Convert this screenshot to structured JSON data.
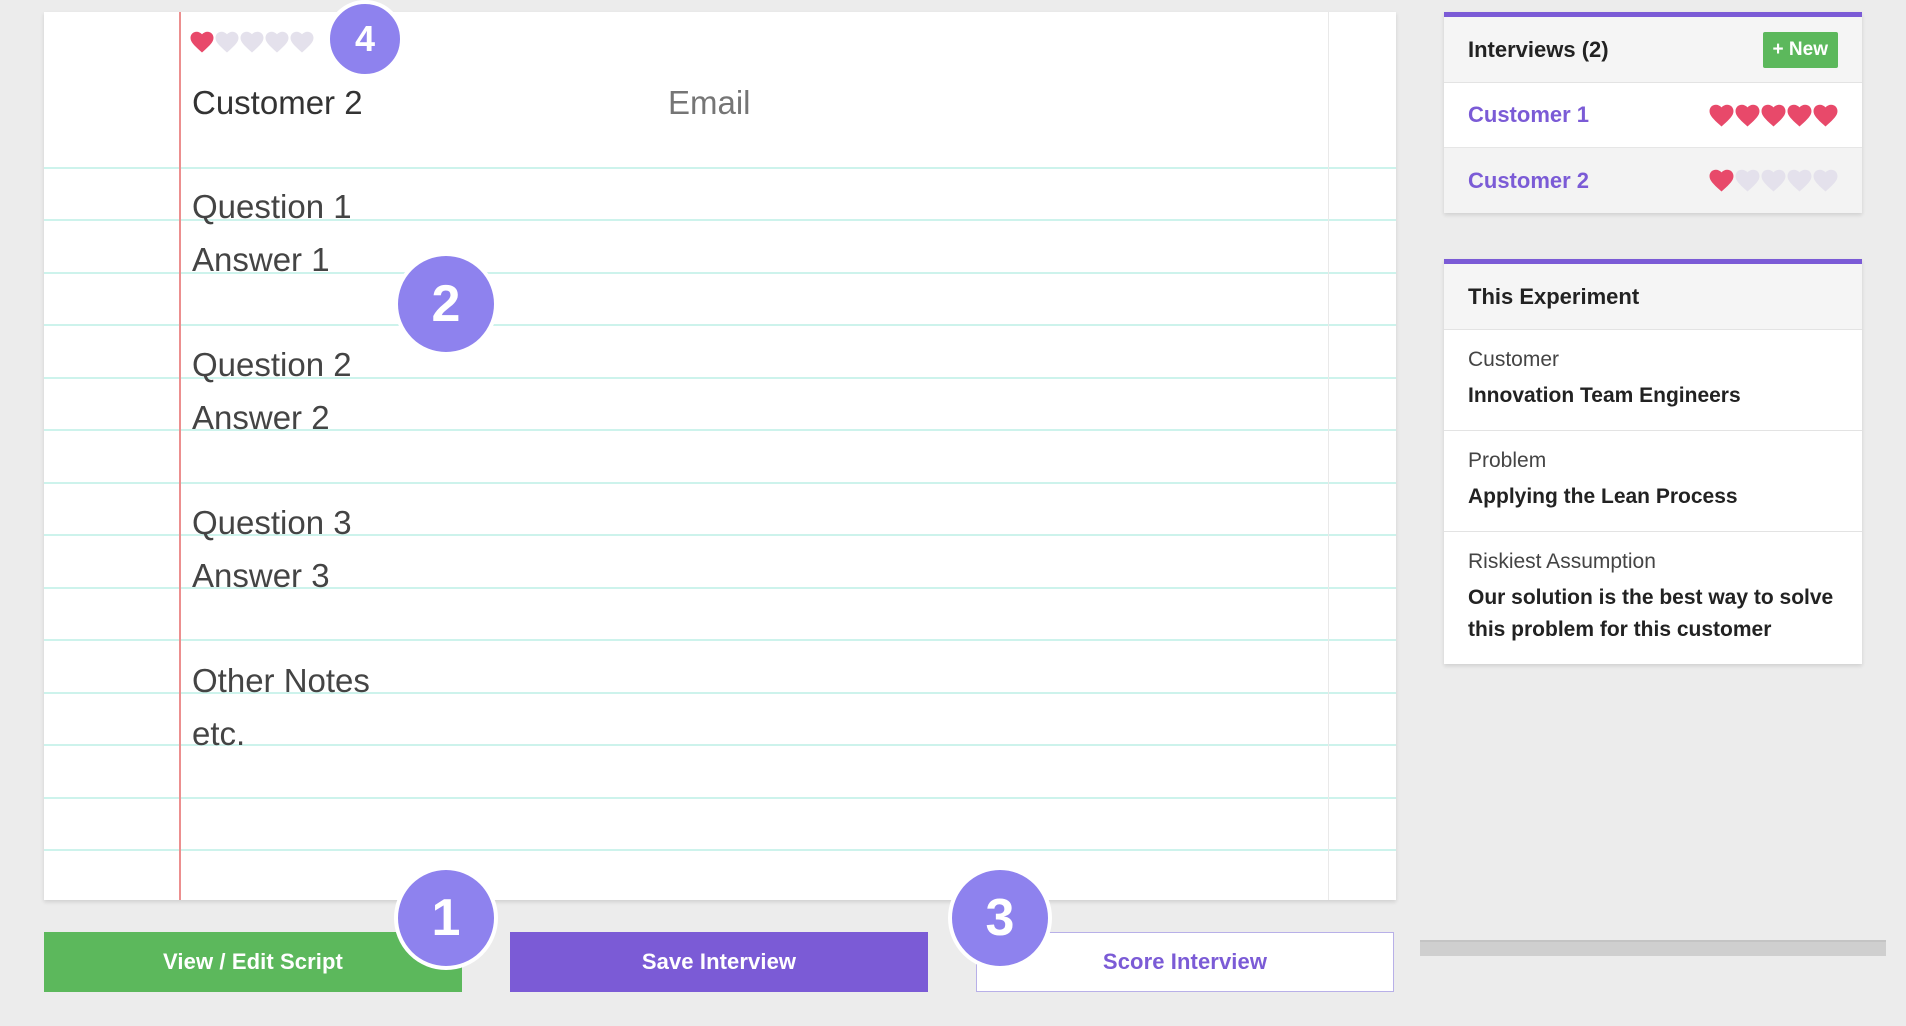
{
  "colors": {
    "accent_purple": "#7b5bd6",
    "button_green": "#5cb85c",
    "badge_purple": "#8e82ee",
    "heart_filled": "#e8496a",
    "heart_empty": "#e4e1ec",
    "paper_rule": "#cdf3ec",
    "paper_margin": "#ec8f8f"
  },
  "notebook": {
    "rating": 1,
    "rating_max": 5,
    "customer_name": "Customer 2",
    "email_placeholder": "Email",
    "lines": [
      "Question 1",
      "Answer 1",
      "Question 2",
      "Answer 2",
      "Question 3",
      "Answer 3",
      "Other Notes",
      "etc."
    ]
  },
  "callouts": {
    "one": "1",
    "two": "2",
    "three": "3",
    "four": "4"
  },
  "buttons": {
    "view_edit_script": "View / Edit Script",
    "save_interview": "Save Interview",
    "score_interview": "Score Interview"
  },
  "sidebar": {
    "interviews": {
      "title": "Interviews (2)",
      "new_label": "+ New",
      "items": [
        {
          "name": "Customer 1",
          "rating": 5,
          "active": false
        },
        {
          "name": "Customer 2",
          "rating": 1,
          "active": true
        }
      ]
    },
    "experiment": {
      "title": "This Experiment",
      "fields": [
        {
          "label": "Customer",
          "value": "Innovation Team Engineers"
        },
        {
          "label": "Problem",
          "value": "Applying the Lean Process"
        },
        {
          "label": "Riskiest Assumption",
          "value": "Our solution is the best way to solve this problem for this customer"
        }
      ]
    }
  },
  "icons": {
    "rating_heart": "heart-icon"
  }
}
